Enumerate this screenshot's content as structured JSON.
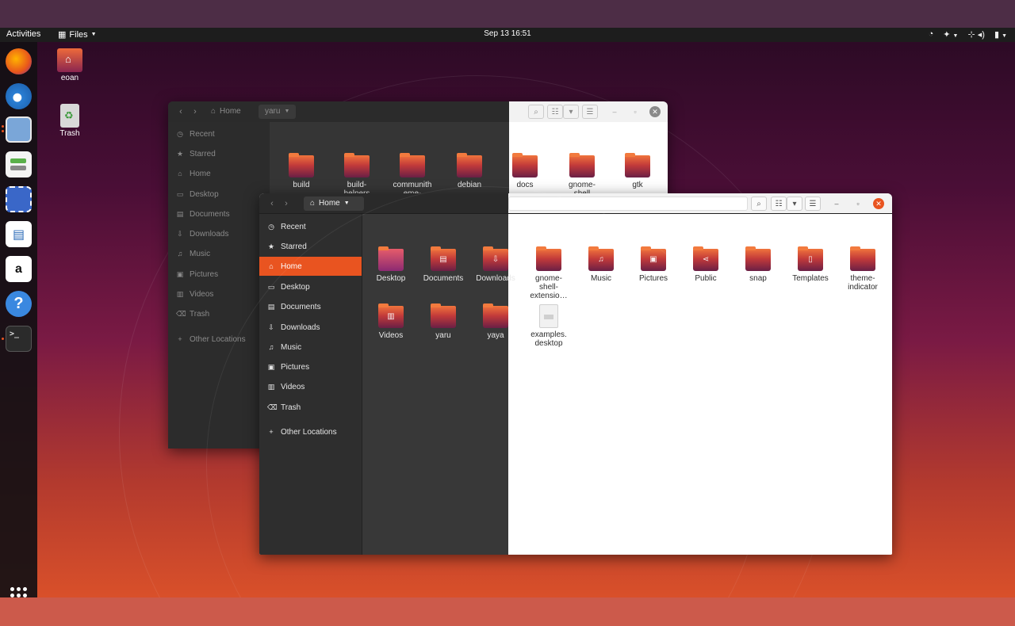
{
  "topbar": {
    "activities": "Activities",
    "app_name": "Files",
    "clock": "Sep 13  16:51"
  },
  "desktop_icons": [
    {
      "label": "eoan"
    },
    {
      "label": "Trash"
    }
  ],
  "back_window": {
    "breadcrumbs": [
      "Home",
      "yaru"
    ],
    "sidebar": [
      "Recent",
      "Starred",
      "Home",
      "Desktop",
      "Documents",
      "Downloads",
      "Music",
      "Pictures",
      "Videos",
      "Trash",
      "Other Locations"
    ],
    "folders": [
      "build",
      "build-\nhelpers",
      "communith\neme-\ncompat",
      "debian",
      "docs",
      "gnome-\nshell",
      "gtk"
    ]
  },
  "front_window": {
    "breadcrumb": "Home",
    "sidebar": [
      {
        "label": "Recent",
        "icon": "clock-icon",
        "glyph": "◷"
      },
      {
        "label": "Starred",
        "icon": "star-icon",
        "glyph": "★"
      },
      {
        "label": "Home",
        "icon": "home-icon",
        "glyph": "⌂"
      },
      {
        "label": "Desktop",
        "icon": "desktop-icon",
        "glyph": "▭"
      },
      {
        "label": "Documents",
        "icon": "documents-icon",
        "glyph": "▤"
      },
      {
        "label": "Downloads",
        "icon": "download-icon",
        "glyph": "⇩"
      },
      {
        "label": "Music",
        "icon": "music-icon",
        "glyph": "♫"
      },
      {
        "label": "Pictures",
        "icon": "pictures-icon",
        "glyph": "▣"
      },
      {
        "label": "Videos",
        "icon": "videos-icon",
        "glyph": "▥"
      },
      {
        "label": "Trash",
        "icon": "trash-icon",
        "glyph": "⌫"
      },
      {
        "label": "Other Locations",
        "icon": "plus-icon",
        "glyph": "+"
      }
    ],
    "active_sidebar": "Home",
    "files": [
      {
        "label": "Desktop",
        "kind": "plain",
        "glyph": ""
      },
      {
        "label": "Documents",
        "kind": "folder",
        "glyph": "▤"
      },
      {
        "label": "Downloads",
        "kind": "folder",
        "glyph": "⇩"
      },
      {
        "label": "gnome-\nshell-\nextensio…",
        "kind": "folder",
        "glyph": ""
      },
      {
        "label": "Music",
        "kind": "folder",
        "glyph": "♫"
      },
      {
        "label": "Pictures",
        "kind": "folder",
        "glyph": "▣"
      },
      {
        "label": "Public",
        "kind": "folder",
        "glyph": "⋖"
      },
      {
        "label": "snap",
        "kind": "folder",
        "glyph": ""
      },
      {
        "label": "Templates",
        "kind": "folder",
        "glyph": "▯"
      },
      {
        "label": "theme-\nindicator",
        "kind": "folder",
        "glyph": ""
      },
      {
        "label": "Videos",
        "kind": "folder",
        "glyph": "▥"
      },
      {
        "label": "yaru",
        "kind": "folder",
        "glyph": ""
      },
      {
        "label": "yaya",
        "kind": "folder",
        "glyph": ""
      },
      {
        "label": "examples.\ndesktop",
        "kind": "file",
        "glyph": ""
      }
    ]
  },
  "colors": {
    "accent": "#e95420",
    "dark_bg": "#383838",
    "light_bg": "#ffffff"
  }
}
